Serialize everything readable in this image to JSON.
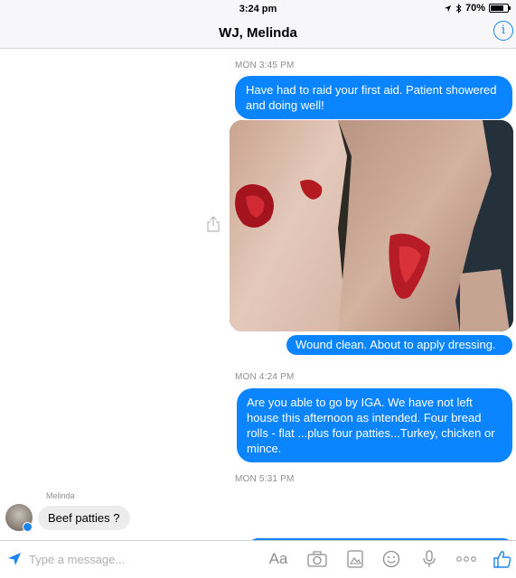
{
  "status_bar": {
    "time": "3:24 pm",
    "battery": "70%"
  },
  "header": {
    "title": "WJ, Melinda"
  },
  "messages": {
    "ts1": "MON 3:45 PM",
    "out1": "Have had to raid your first aid. Patient showered and doing well!",
    "out2": "Wound clean. About to apply dressing.",
    "ts2": "MON 4:24 PM",
    "out3": "Are you able to go by IGA. We have not left house this afternoon as intended. Four bread rolls - flat ...plus four patties...Turkey, chicken or mince.",
    "ts3": "MON 5:31 PM",
    "sender": "Melinda",
    "in1": "Beef patties ?"
  },
  "composer": {
    "placeholder": "Type a message...",
    "text_style_label": "Aa"
  },
  "colors": {
    "accent": "#0a84ff",
    "incoming_bubble": "#ececed"
  }
}
